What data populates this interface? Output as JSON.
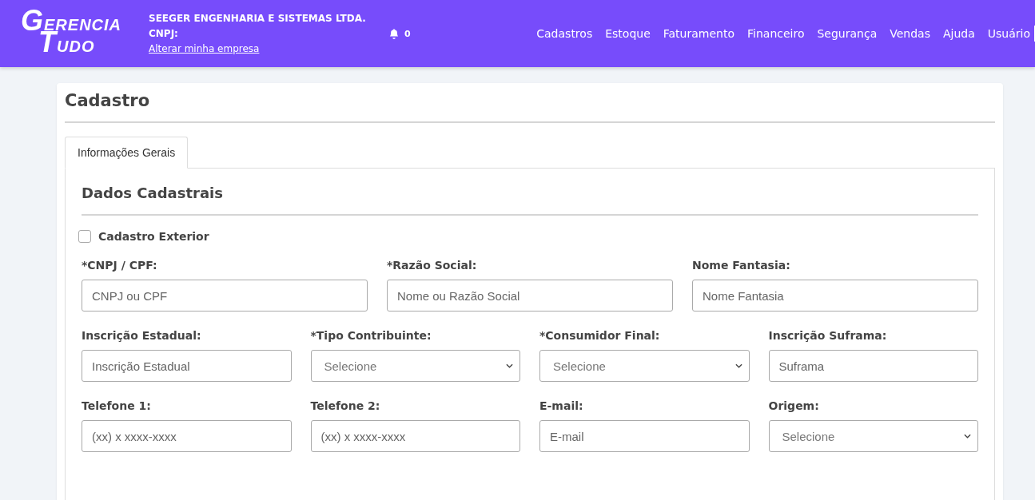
{
  "header": {
    "logo": [
      "GERENCIA",
      "TUDO"
    ],
    "company": "SEEGER ENGENHARIA E SISTEMAS LTDA.",
    "cnpj_label": "CNPJ:",
    "change_company_link": "Alterar minha empresa",
    "notifications": "0",
    "nav": [
      "Cadastros",
      "Estoque",
      "Faturamento",
      "Financeiro",
      "Segurança",
      "Vendas",
      "Ajuda",
      "Usuário"
    ]
  },
  "page": {
    "title": "Cadastro",
    "tabs": [
      {
        "label": "Informações Gerais",
        "selected": true
      }
    ],
    "section_title": "Dados Cadastrais",
    "exterior_checkbox": {
      "label": "Cadastro Exterior",
      "checked": false
    },
    "rows": [
      [
        {
          "label": "*CNPJ / CPF:",
          "kind": "input",
          "placeholder": "CNPJ ou CPF"
        },
        {
          "label": "*Razão Social:",
          "kind": "input",
          "placeholder": "Nome ou Razão Social"
        },
        {
          "label": "Nome Fantasia:",
          "kind": "input",
          "placeholder": "Nome Fantasia"
        }
      ],
      [
        {
          "label": "Inscrição Estadual:",
          "kind": "input",
          "placeholder": "Inscrição Estadual"
        },
        {
          "label": "*Tipo Contribuinte:",
          "kind": "select",
          "value": "Selecione"
        },
        {
          "label": "*Consumidor Final:",
          "kind": "select",
          "value": "Selecione"
        },
        {
          "label": "Inscrição Suframa:",
          "kind": "input",
          "placeholder": "Suframa"
        }
      ],
      [
        {
          "label": "Telefone 1:",
          "kind": "input",
          "placeholder": "(xx) x xxxx-xxxx"
        },
        {
          "label": "Telefone 2:",
          "kind": "input",
          "placeholder": "(xx) x xxxx-xxxx"
        },
        {
          "label": "E-mail:",
          "kind": "input",
          "placeholder": "E-mail"
        },
        {
          "label": "Origem:",
          "kind": "select",
          "value": "Selecione"
        }
      ]
    ]
  }
}
